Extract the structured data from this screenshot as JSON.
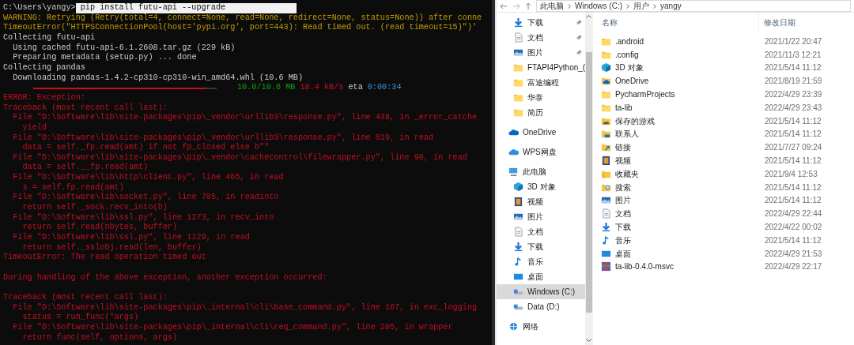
{
  "terminal": {
    "prompt": {
      "path": "C:\\Users\\yangy>",
      "command": "pip install futu-api --upgrade",
      "selected": true
    },
    "lines": [
      {
        "kind": "warning",
        "text": "WARNING: Retrying (Retry(total=4, connect=None, read=None, redirect=None, status=None)) after conne"
      },
      {
        "kind": "warning",
        "text": "TimeoutError(\"HTTPSConnectionPool(host='pypi.org', port=443): Read timed out. (read timeout=15)\")'"
      },
      {
        "kind": "normal",
        "text": "Collecting futu-api"
      },
      {
        "kind": "normal",
        "text": "  Using cached futu-api-6.1.2608.tar.gz (229 kB)"
      },
      {
        "kind": "normal",
        "text": "  Preparing metadata (setup.py) ... done"
      },
      {
        "kind": "normal",
        "text": "Collecting pandas"
      },
      {
        "kind": "normal",
        "text": "  Downloading pandas-1.4.2-cp310-cp310-win_amd64.whl (10.6 MB)"
      },
      {
        "kind": "progress",
        "level": 0.94,
        "segments": [
          {
            "kind": "size",
            "text": "10.0/10.6 MB"
          },
          {
            "kind": "rate",
            "text": "18.4 kB/s"
          },
          {
            "kind": "label",
            "text": "eta"
          },
          {
            "kind": "eta",
            "text": "0:00:34"
          }
        ]
      },
      {
        "kind": "error",
        "text": "ERROR: Exception:"
      },
      {
        "kind": "error",
        "text": "Traceback (most recent call last):"
      },
      {
        "kind": "error",
        "text": "  File \"D:\\Software\\lib\\site-packages\\pip\\_vendor\\urllib3\\response.py\", line 438, in _error_catche"
      },
      {
        "kind": "error",
        "text": "    yield"
      },
      {
        "kind": "error",
        "text": "  File \"D:\\Software\\lib\\site-packages\\pip\\_vendor\\urllib3\\response.py\", line 519, in read"
      },
      {
        "kind": "error",
        "text": "    data = self._fp.read(amt) if not fp_closed else b\"\""
      },
      {
        "kind": "error",
        "text": "  File \"D:\\Software\\lib\\site-packages\\pip\\_vendor\\cachecontrol\\filewrapper.py\", line 90, in read"
      },
      {
        "kind": "error",
        "text": "    data = self.__fp.read(amt)"
      },
      {
        "kind": "error",
        "text": "  File \"D:\\Software\\lib\\http\\client.py\", line 465, in read"
      },
      {
        "kind": "error",
        "text": "    s = self.fp.read(amt)"
      },
      {
        "kind": "error",
        "text": "  File \"D:\\Software\\lib\\socket.py\", line 705, in readinto"
      },
      {
        "kind": "error",
        "text": "    return self._sock.recv_into(b)"
      },
      {
        "kind": "error",
        "text": "  File \"D:\\Software\\lib\\ssl.py\", line 1273, in recv_into"
      },
      {
        "kind": "error",
        "text": "    return self.read(nbytes, buffer)"
      },
      {
        "kind": "error",
        "text": "  File \"D:\\Software\\lib\\ssl.py\", line 1129, in read"
      },
      {
        "kind": "error",
        "text": "    return self._sslobj.read(len, buffer)"
      },
      {
        "kind": "error",
        "text": "TimeoutError: The read operation timed out"
      },
      {
        "kind": "blank"
      },
      {
        "kind": "error",
        "text": "During handling of the above exception, another exception occurred:"
      },
      {
        "kind": "blank"
      },
      {
        "kind": "error",
        "text": "Traceback (most recent call last):"
      },
      {
        "kind": "error",
        "text": "  File \"D:\\Software\\lib\\site-packages\\pip\\_internal\\cli\\base_command.py\", line 167, in exc_logging"
      },
      {
        "kind": "error",
        "text": "    status = run_func(*args)"
      },
      {
        "kind": "error",
        "text": "  File \"D:\\Software\\lib\\site-packages\\pip\\_internal\\cli\\req_command.py\", line 205, in wrapper"
      },
      {
        "kind": "error",
        "text": "    return func(self, options, args)"
      }
    ]
  },
  "explorer": {
    "breadcrumb": [
      "此电脑",
      "Windows (C:)",
      "用户",
      "yangy"
    ],
    "sidebar": {
      "quick_access": [
        {
          "label": "下载",
          "kind": "download",
          "pinned": true
        },
        {
          "label": "文档",
          "kind": "document",
          "pinned": true
        },
        {
          "label": "图片",
          "kind": "picture",
          "pinned": true
        },
        {
          "label": "FTAPI4Python_(",
          "kind": "folder",
          "pinned": false
        },
        {
          "label": "富途编程",
          "kind": "folder",
          "pinned": false
        },
        {
          "label": "华泰",
          "kind": "folder",
          "pinned": false
        },
        {
          "label": "简历",
          "kind": "folder",
          "pinned": false
        }
      ],
      "items": [
        {
          "label": "OneDrive",
          "kind": "onedrive",
          "selected": false
        },
        {
          "label": "WPS网盘",
          "kind": "cloud",
          "selected": false
        },
        {
          "label": "此电脑",
          "kind": "pc",
          "selected": false,
          "children": [
            {
              "label": "3D 对象",
              "kind": "cube",
              "selected": false
            },
            {
              "label": "视频",
              "kind": "video",
              "selected": false
            },
            {
              "label": "图片",
              "kind": "picture",
              "selected": false
            },
            {
              "label": "文档",
              "kind": "document",
              "selected": false
            },
            {
              "label": "下载",
              "kind": "download",
              "selected": false
            },
            {
              "label": "音乐",
              "kind": "music",
              "selected": false
            },
            {
              "label": "桌面",
              "kind": "desktop",
              "selected": false
            },
            {
              "label": "Windows (C:)",
              "kind": "drive",
              "selected": true
            },
            {
              "label": "Data (D:)",
              "kind": "drive",
              "selected": false
            }
          ]
        },
        {
          "label": "网络",
          "kind": "network",
          "selected": false
        }
      ]
    },
    "columns": [
      "名称",
      "修改日期"
    ],
    "rows": [
      {
        "name": ".android",
        "kind": "folder",
        "date": "2021/1/22 20:47"
      },
      {
        "name": ".config",
        "kind": "folder",
        "date": "2021/11/3 12:21"
      },
      {
        "name": "3D 对象",
        "kind": "cube",
        "date": "2021/5/14 11:12"
      },
      {
        "name": "OneDrive",
        "kind": "onedrive-folder",
        "date": "2021/8/19 21:59"
      },
      {
        "name": "PycharmProjects",
        "kind": "folder",
        "date": "2022/4/29 23:39"
      },
      {
        "name": "ta-lib",
        "kind": "folder",
        "date": "2022/4/29 23:43"
      },
      {
        "name": "保存的游戏",
        "kind": "games",
        "date": "2021/5/14 11:12"
      },
      {
        "name": "联系人",
        "kind": "contacts",
        "date": "2021/5/14 11:12"
      },
      {
        "name": "链接",
        "kind": "link",
        "date": "2021/7/27 09:24"
      },
      {
        "name": "视频",
        "kind": "video",
        "date": "2021/5/14 11:12"
      },
      {
        "name": "收藏夹",
        "kind": "favorites",
        "date": "2021/9/4 12:53"
      },
      {
        "name": "搜索",
        "kind": "search",
        "date": "2021/5/14 11:12"
      },
      {
        "name": "图片",
        "kind": "picture",
        "date": "2021/5/14 11:12"
      },
      {
        "name": "文档",
        "kind": "document",
        "date": "2022/4/29 22:44"
      },
      {
        "name": "下载",
        "kind": "download",
        "date": "2022/4/22 00:02"
      },
      {
        "name": "音乐",
        "kind": "music",
        "date": "2021/5/14 11:12"
      },
      {
        "name": "桌面",
        "kind": "desktop",
        "date": "2022/4/29 21:53"
      },
      {
        "name": "ta-lib-0.4.0-msvc",
        "kind": "archive",
        "date": "2022/4/29 22:17"
      }
    ]
  }
}
